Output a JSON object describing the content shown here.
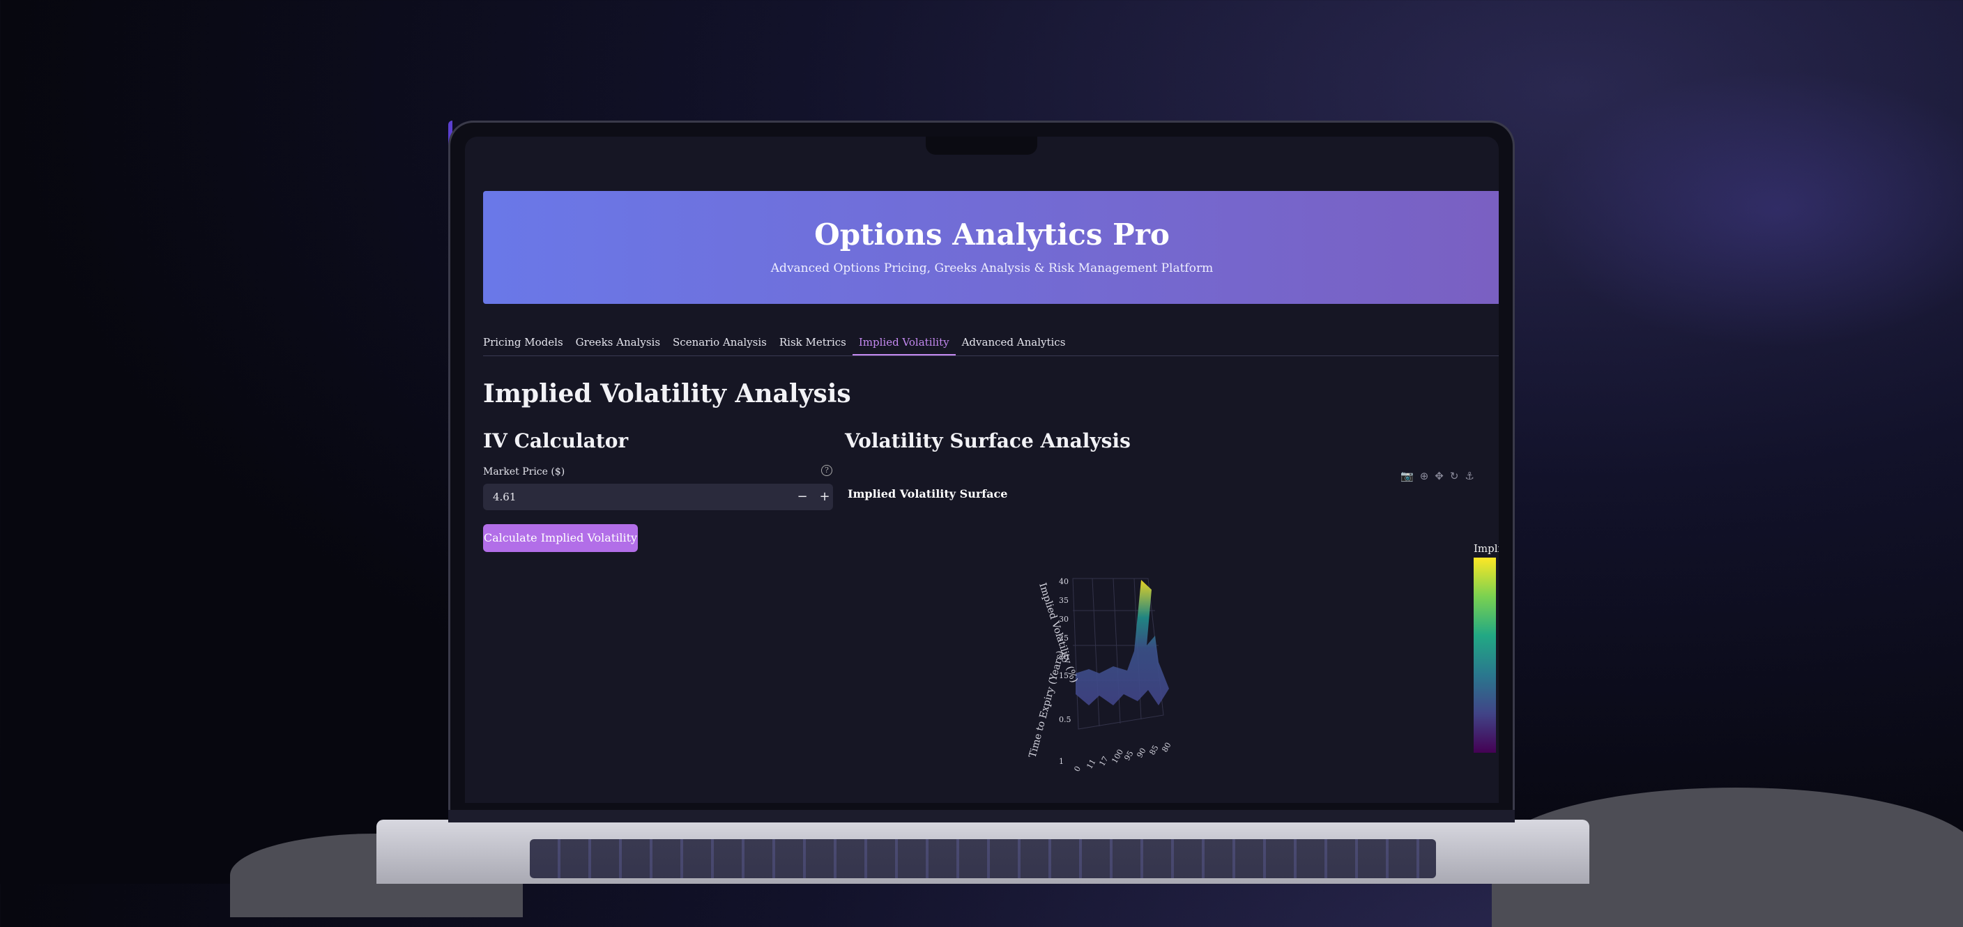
{
  "app": {
    "title": "Options Analytics Pro",
    "subtitle": "Advanced Options Pricing, Greeks Analysis & Risk Management Platform"
  },
  "tabs": [
    {
      "label": "Pricing Models",
      "active": false
    },
    {
      "label": "Greeks Analysis",
      "active": false
    },
    {
      "label": "Scenario Analysis",
      "active": false
    },
    {
      "label": "Risk Metrics",
      "active": false
    },
    {
      "label": "Implied Volatility",
      "active": true
    },
    {
      "label": "Advanced Analytics",
      "active": false
    }
  ],
  "page": {
    "heading": "Implied Volatility Analysis"
  },
  "calculator": {
    "heading": "IV Calculator",
    "market_price_label": "Market Price ($)",
    "help_glyph": "?",
    "market_price_value": "4.61",
    "minus_glyph": "−",
    "plus_glyph": "+",
    "calculate_label": "Calculate Implied Volatility"
  },
  "surface": {
    "heading": "Volatility Surface Analysis",
    "plot_title": "Implied Volatility Surface",
    "colorbar_title": "Impli",
    "toolbar_icons": [
      "camera-icon",
      "zoom-icon",
      "pan-icon",
      "orbit-rotation-icon",
      "reset-camera-icon"
    ],
    "accent_colors": {
      "header_start": "#6a78e8",
      "header_end": "#7a60c2",
      "active_tab": "#c489f0",
      "button": "#b26ee8"
    }
  },
  "chart_data": {
    "type": "surface",
    "title": "Implied Volatility Surface",
    "xlabel": "Time to Expiry (Years)",
    "zlabel": "Implied Volatility (%)",
    "z_ticks": [
      "40",
      "35",
      "30",
      "25",
      "20",
      "15"
    ],
    "y_ticks": [
      "0.5",
      "1"
    ],
    "x_ticks": [
      "0",
      "11",
      "17",
      "100",
      "95",
      "90",
      "85",
      "80"
    ],
    "colorscale": "viridis"
  }
}
